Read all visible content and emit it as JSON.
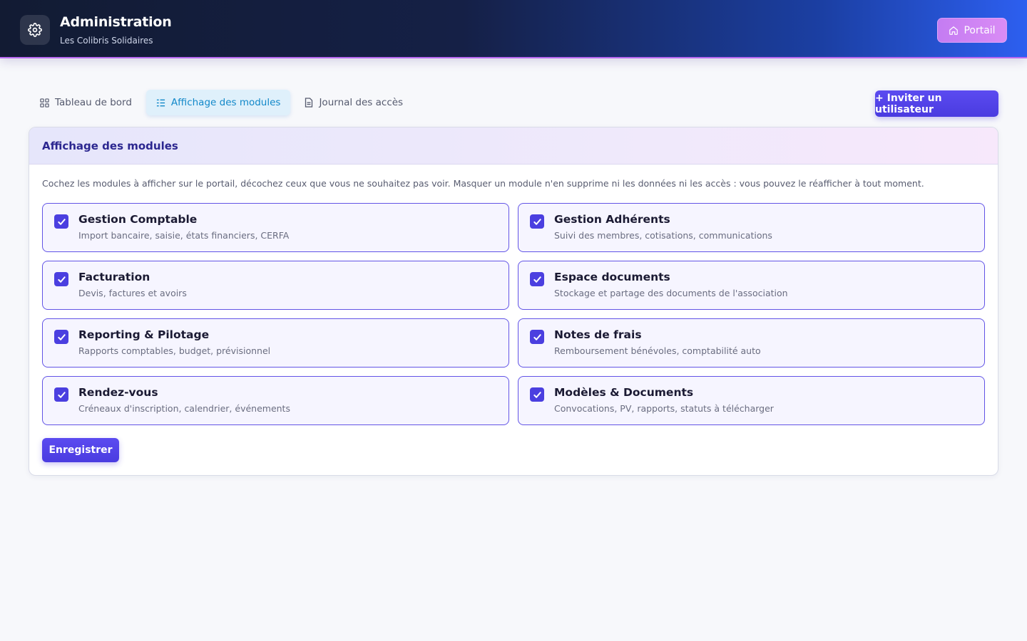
{
  "header": {
    "title": "Administration",
    "subtitle": "Les Colibris Solidaires",
    "portal_label": "Portail",
    "icons": {
      "logo": "gear-icon",
      "portal": "home-icon"
    }
  },
  "tabs": [
    {
      "label": "Tableau de bord",
      "icon": "grid-icon",
      "active": false
    },
    {
      "label": "Affichage des modules",
      "icon": "list-icon",
      "active": true
    },
    {
      "label": "Journal des accès",
      "icon": "document-icon",
      "active": false
    }
  ],
  "invite_label": "+ Inviter un utilisateur",
  "panel": {
    "title": "Affichage des modules",
    "description": "Cochez les modules à afficher sur le portail, décochez ceux que vous ne souhaitez pas voir. Masquer un module n'en supprime ni les données ni les accès : vous pouvez le réafficher à tout moment.",
    "save_label": "Enregistrer"
  },
  "modules": [
    {
      "title": "Gestion Comptable",
      "description": "Import bancaire, saisie, états financiers, CERFA",
      "checked": true
    },
    {
      "title": "Gestion Adhérents",
      "description": "Suivi des membres, cotisations, communications",
      "checked": true
    },
    {
      "title": "Facturation",
      "description": "Devis, factures et avoirs",
      "checked": true
    },
    {
      "title": "Espace documents",
      "description": "Stockage et partage des documents de l'association",
      "checked": true
    },
    {
      "title": "Reporting & Pilotage",
      "description": "Rapports comptables, budget, prévisionnel",
      "checked": true
    },
    {
      "title": "Notes de frais",
      "description": "Remboursement bénévoles, comptabilité auto",
      "checked": true
    },
    {
      "title": "Rendez-vous",
      "description": "Créneaux d'inscription, calendrier, événements",
      "checked": true
    },
    {
      "title": "Modèles & Documents",
      "description": "Convocations, PV, rapports, statuts à télécharger",
      "checked": true
    }
  ],
  "colors": {
    "accent": "#4b3fe0",
    "active_tab_bg": "#dff0fb",
    "active_tab_text": "#1288c9",
    "portal_button": "#c47cf2"
  }
}
